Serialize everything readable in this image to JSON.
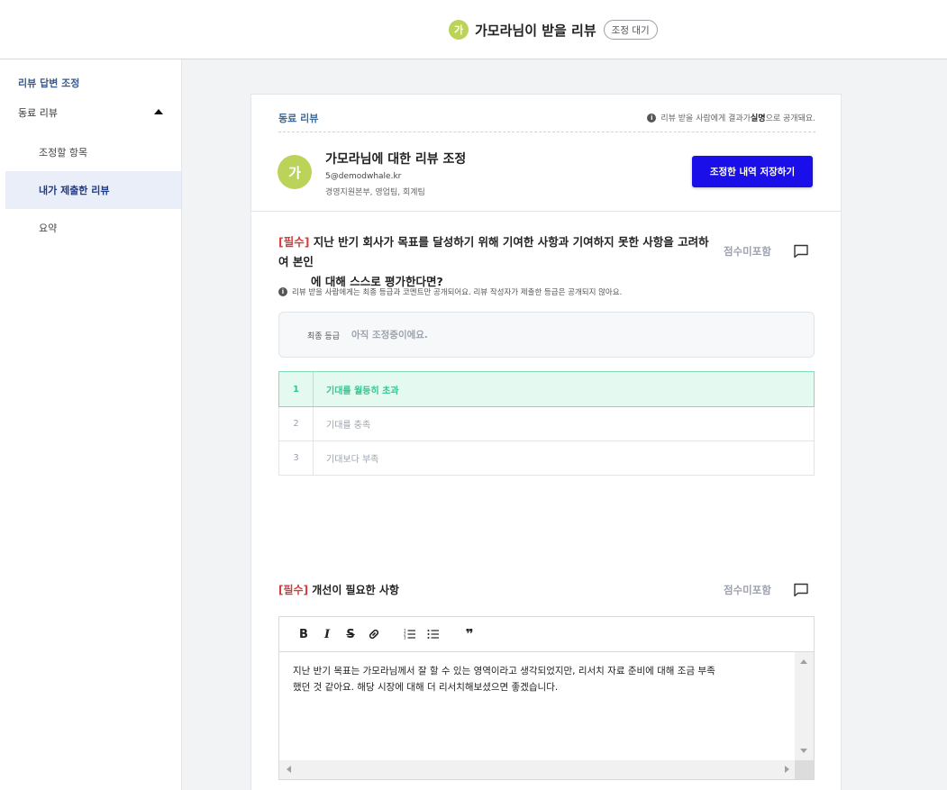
{
  "header": {
    "avatar_initial": "가",
    "title": "가모라님이 받을 리뷰",
    "status_badge": "조정 대기"
  },
  "sidebar": {
    "heading": "리뷰 답변 조정",
    "group_label": "동료 리뷰",
    "items": [
      {
        "label": "조정할 항목",
        "active": false
      },
      {
        "label": "내가 제출한 리뷰",
        "active": true
      },
      {
        "label": "요약",
        "active": false
      }
    ]
  },
  "card": {
    "section_label": "동료 리뷰",
    "notice_prefix": "리뷰 받을 사람에게 결과가 ",
    "notice_bold": "실명",
    "notice_suffix": "으로 공개돼요.",
    "reviewee": {
      "avatar_initial": "가",
      "title": "가모라님에 대한 리뷰 조정",
      "email": "5@demodwhale.kr",
      "dept": "경영지원본부, 영업팀, 회계팀"
    },
    "save_button": "조정한 내역 저장하기"
  },
  "question1": {
    "required_tag": "[필수]",
    "text_line1": " 지난 반기 회사가 목표를 달성하기 위해 기여한 사항과 기여하지 못한 사항을 고려하여 본인",
    "text_line2": "에 대해 스스로 평가한다면?",
    "score_label": "점수미포함",
    "note": "리뷰 받을 사람에게는 최종 등급과 코멘트만 공개되어요. 리뷰 작성자가 제출한 등급은 공개되지 않아요.",
    "final_grade_label": "최종 등급",
    "final_grade_value": "아직 조정중이에요.",
    "grades": [
      {
        "num": "1",
        "label": "기대를 월등히 초과",
        "selected": true
      },
      {
        "num": "2",
        "label": "기대를 충족",
        "selected": false
      },
      {
        "num": "3",
        "label": "기대보다 부족",
        "selected": false
      }
    ]
  },
  "question2": {
    "required_tag": "[필수]",
    "text": " 개선이 필요한 사항",
    "score_label": "점수미포함",
    "toolbar": {
      "bold": "B",
      "italic": "I",
      "strike": "S",
      "quote": "❞"
    },
    "answer_line1": "지난 반기 목표는 가모라님께서 잘 할 수 있는 영역이라고 생각되었지만, 리서치 자료 준비에 대해 조금 부족",
    "answer_line2": "했던 것 같아요. 해당 시장에 대해 더 리서치해보셨으면 좋겠습니다."
  },
  "colors": {
    "primary_button": "#1a0fe8",
    "avatar": "#bcd35a",
    "required": "#d83a3a",
    "selected_grade": "#37c58f"
  }
}
